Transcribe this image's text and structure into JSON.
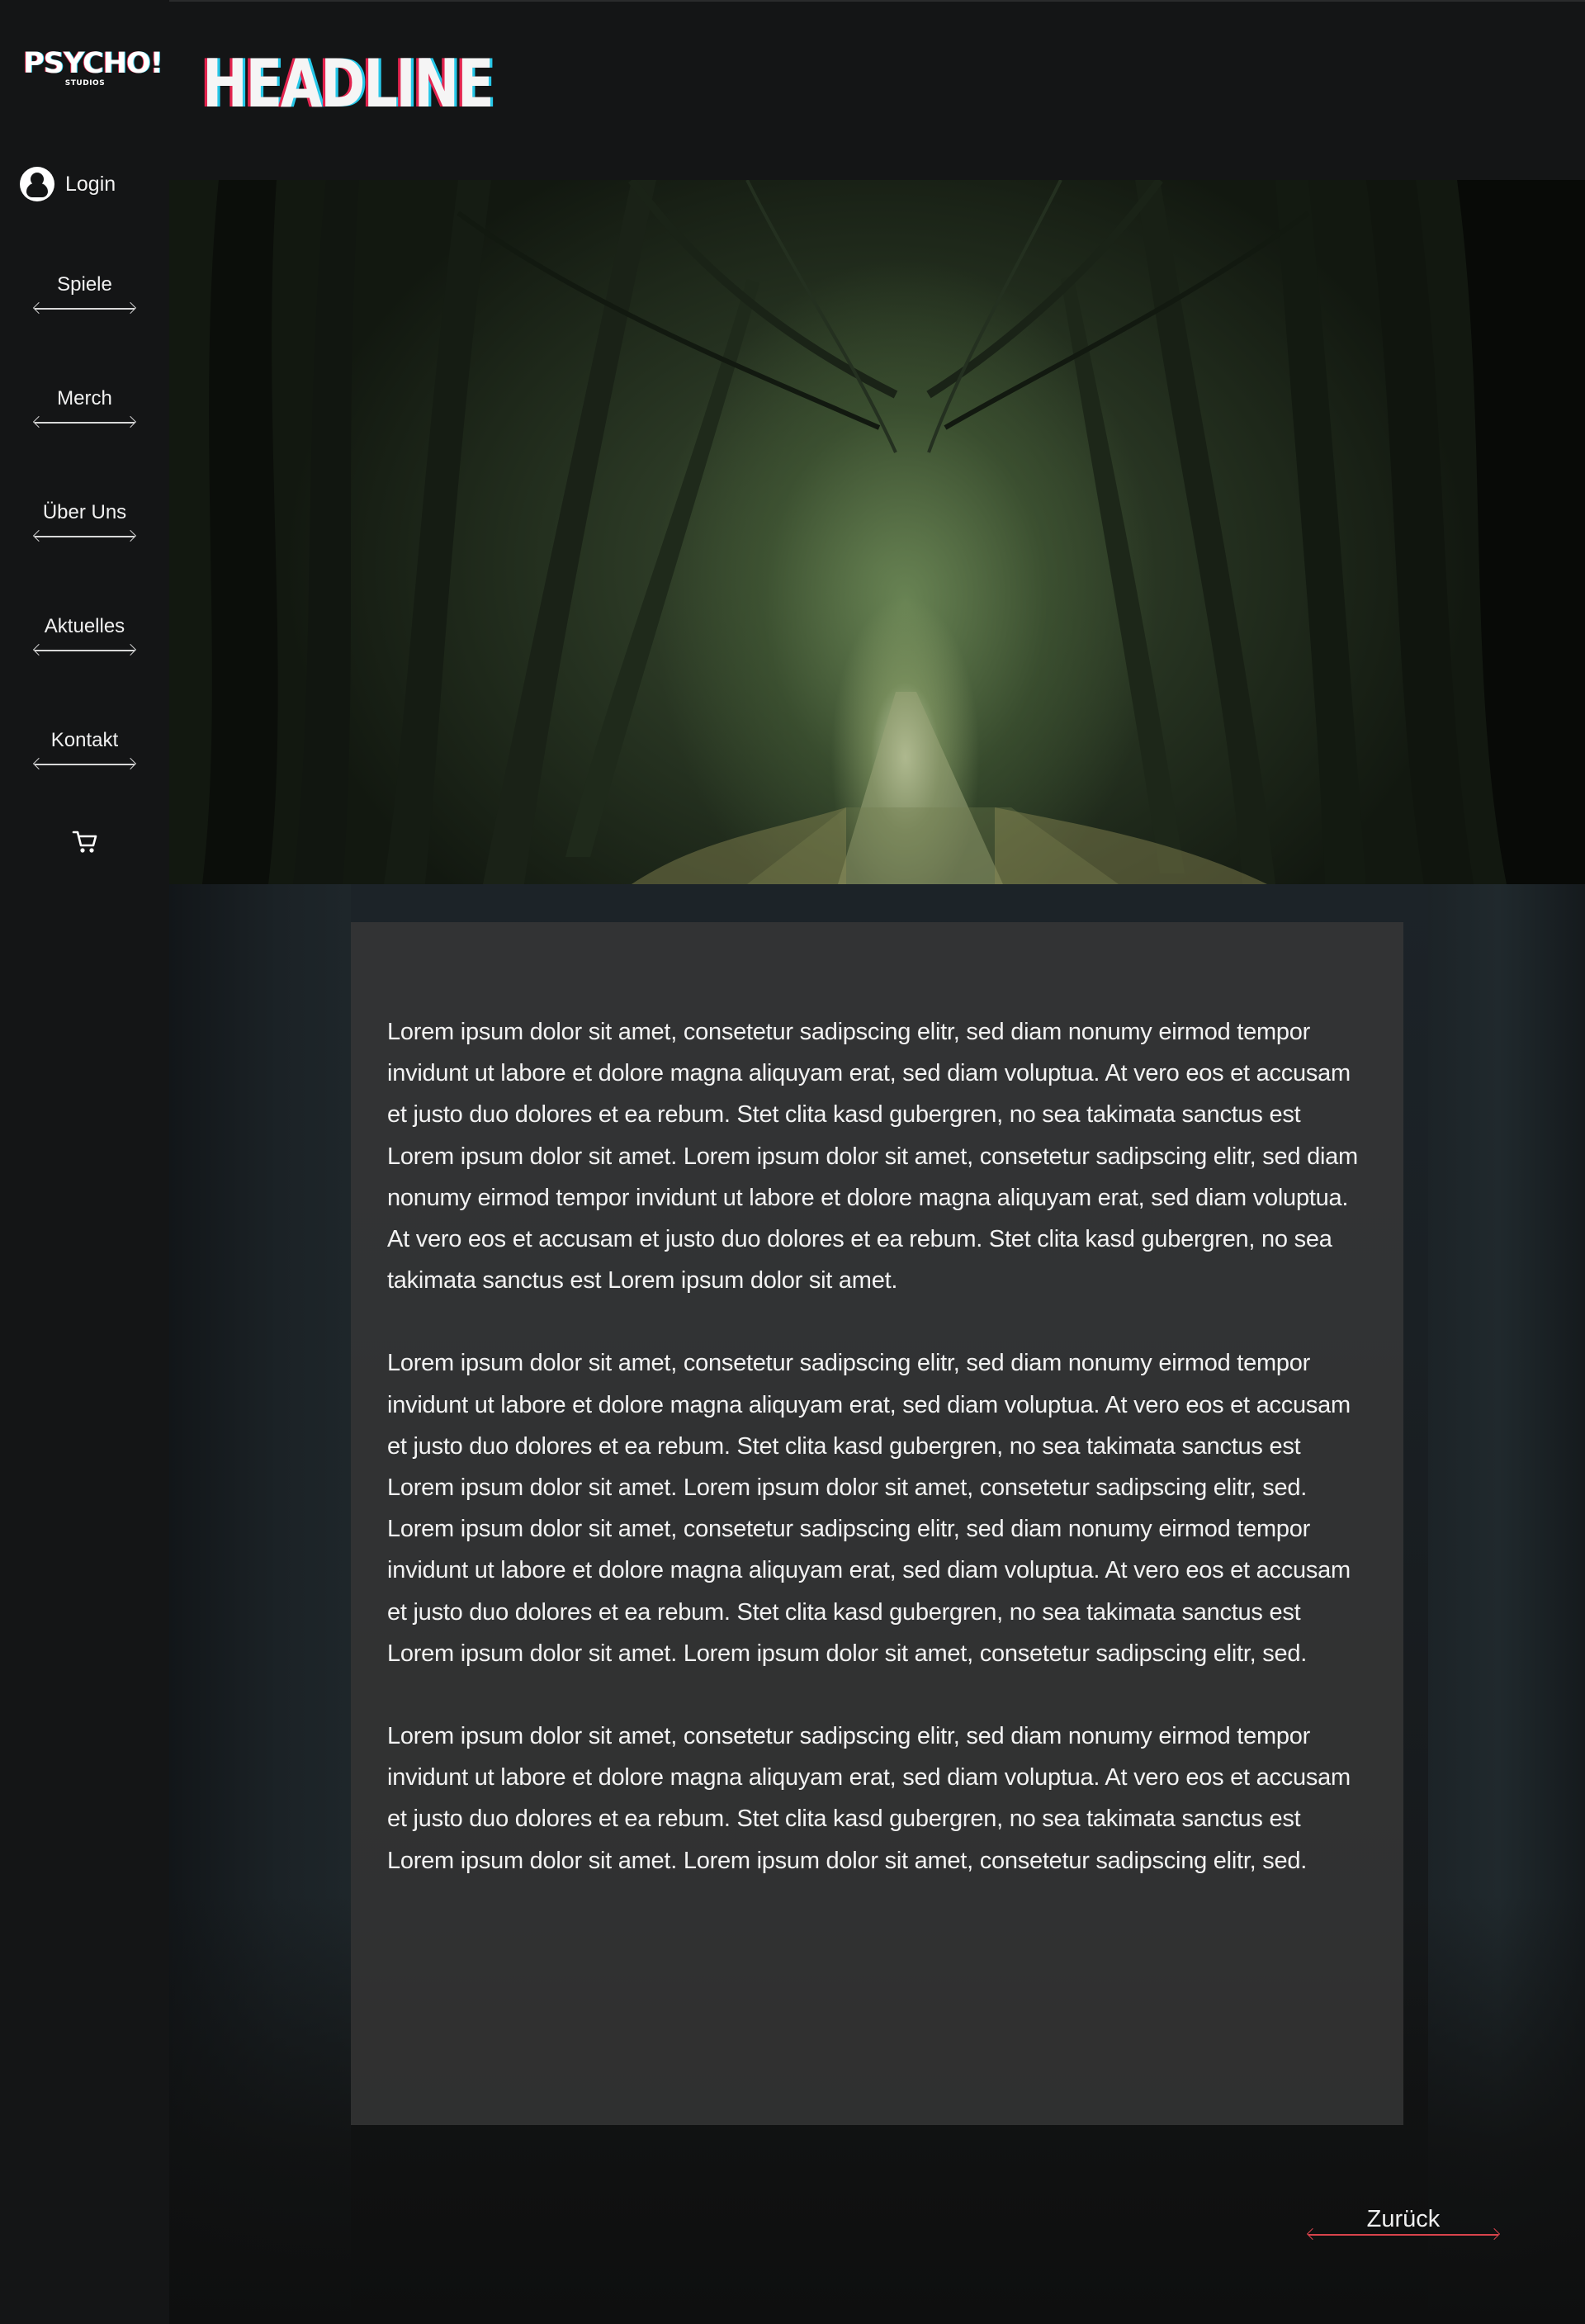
{
  "brand": {
    "logo_main": "PSYCHO!",
    "logo_sub": "STUDIOS",
    "headline": "HEADLINE",
    "accent_red": "#e3244f",
    "accent_cyan": "#26c7e8"
  },
  "sidebar": {
    "login_label": "Login",
    "login_icon": "user-avatar-icon",
    "items": [
      {
        "label": "Spiele"
      },
      {
        "label": "Merch"
      },
      {
        "label": "Über Uns"
      },
      {
        "label": "Aktuelles"
      },
      {
        "label": "Kontakt"
      }
    ],
    "cart_icon": "shopping-cart-icon"
  },
  "hero": {
    "image": "misty-forest-path"
  },
  "article": {
    "paragraphs": [
      "Lorem ipsum dolor sit amet, consetetur sadipscing elitr, sed diam nonumy eirmod tempor invidunt ut labore et dolore magna aliquyam erat, sed diam voluptua. At vero eos et accusam et justo duo dolores et ea rebum. Stet clita kasd gubergren, no sea takimata sanctus est Lorem ipsum dolor sit amet. Lorem ipsum dolor sit amet, consetetur sadipscing elitr, sed diam nonumy eirmod tempor invidunt ut labore et dolore magna aliquyam erat, sed diam voluptua. At vero eos et accusam et justo duo dolores et ea rebum. Stet clita kasd gubergren, no sea takimata sanctus est Lorem ipsum dolor sit amet.",
      "Lorem ipsum dolor sit amet, consetetur sadipscing elitr, sed diam nonumy eirmod tempor invidunt ut labore et dolore magna aliquyam erat, sed diam voluptua. At vero eos et accusam et justo duo dolores et ea rebum. Stet clita kasd gubergren, no sea takimata sanctus est Lorem ipsum dolor sit amet. Lorem ipsum dolor sit amet, consetetur sadipscing elitr, sed.",
      "Lorem ipsum dolor sit amet, consetetur sadipscing elitr, sed diam nonumy eirmod tempor invidunt ut labore et dolore magna aliquyam erat, sed diam voluptua. At vero eos et accusam et justo duo dolores et ea rebum. Stet clita kasd gubergren, no sea takimata sanctus est Lorem ipsum dolor sit amet. Lorem ipsum dolor sit amet, consetetur sadipscing elitr, sed.",
      "Lorem ipsum dolor sit amet, consetetur sadipscing elitr, sed diam nonumy eirmod tempor invidunt ut labore et dolore magna aliquyam erat, sed diam voluptua. At vero eos et accusam et justo duo dolores et ea rebum. Stet clita kasd gubergren, no sea takimata sanctus est Lorem ipsum dolor sit amet. Lorem ipsum dolor sit amet, consetetur sadipscing elitr, sed."
    ]
  },
  "footer": {
    "back_label": "Zurück"
  }
}
